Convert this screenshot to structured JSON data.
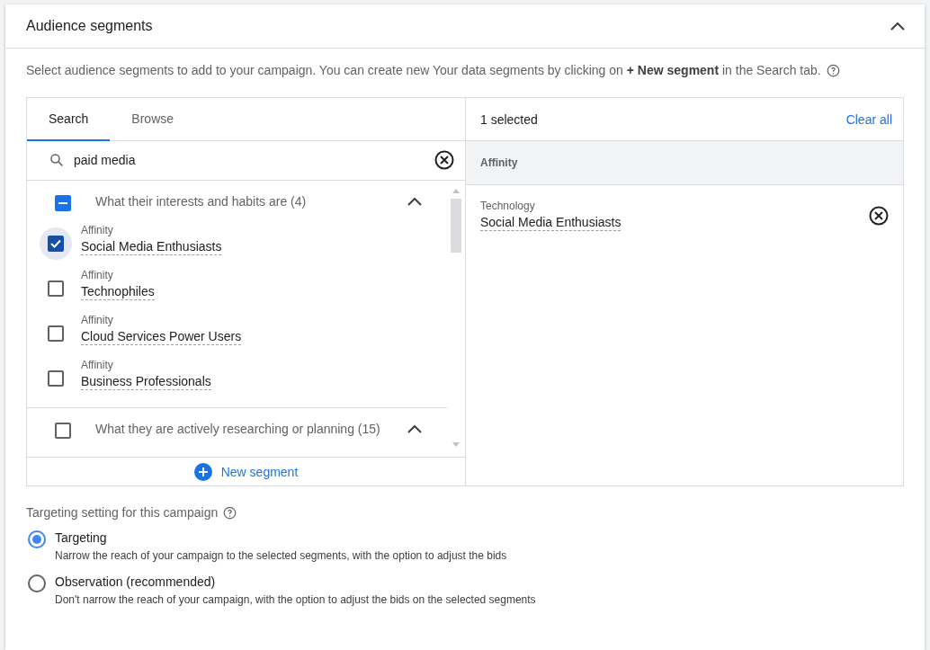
{
  "panel": {
    "title": "Audience segments",
    "expanded": true
  },
  "description": "Select audience segments to add to your campaign. You can create new Your data segments by clicking on **+ New segment** in the Search tab.",
  "tabs": [
    {
      "label": "Search",
      "selected": true
    },
    {
      "label": "Browse",
      "selected": false
    }
  ],
  "search": {
    "value": "paid media"
  },
  "groups": [
    {
      "label": "What their interests and habits are (4)",
      "checked": true,
      "partial": true,
      "expanded": true,
      "items": [
        {
          "category": "Affinity",
          "name": "Social Media Enthusiasts",
          "checked": true
        },
        {
          "category": "Affinity",
          "name": "Technophiles",
          "checked": false
        },
        {
          "category": "Affinity",
          "name": "Cloud Services Power Users",
          "checked": false
        },
        {
          "category": "Affinity",
          "name": "Business Professionals",
          "checked": false
        }
      ]
    },
    {
      "label": "What they are actively researching or planning (15)",
      "checked": false,
      "partial": false,
      "expanded": true
    }
  ],
  "new_segment": "New segment",
  "selection": {
    "count": "1 selected",
    "clear": "Clear all",
    "section": "Affinity",
    "items": [
      {
        "category": "Technology",
        "name": "Social Media Enthusiasts"
      }
    ]
  },
  "targeting": {
    "label": "Targeting setting for this campaign",
    "options": [
      {
        "label": "Targeting",
        "description": "Narrow the reach of your campaign to the selected segments, with the option to adjust the bids",
        "selected": true
      },
      {
        "label": "Observation (recommended)",
        "description": "Don't narrow the reach of your campaign, with the option to adjust the bids on the selected segments",
        "selected": false
      }
    ]
  }
}
